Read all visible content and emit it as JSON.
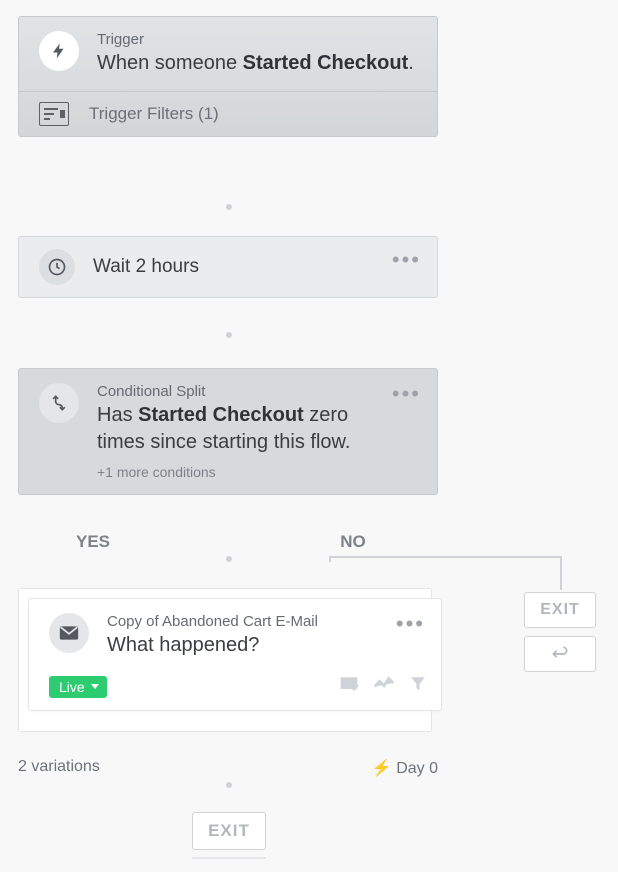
{
  "trigger": {
    "label": "Trigger",
    "prefix": "When someone ",
    "event": "Started Checkout",
    "suffix": ".",
    "filters_label": "Trigger Filters (1)"
  },
  "wait": {
    "text": "Wait 2 hours"
  },
  "split": {
    "label": "Conditional Split",
    "prefix": "Has ",
    "event": "Started Checkout",
    "suffix": " zero times since starting this flow.",
    "more": "+1 more conditions",
    "yes": "YES",
    "no": "NO"
  },
  "email": {
    "label": "Copy of Abandoned Cart E-Mail",
    "subject": "What happened?",
    "status": "Live",
    "variations": "2 variations",
    "day": "Day 0"
  },
  "exit_label": "EXIT"
}
